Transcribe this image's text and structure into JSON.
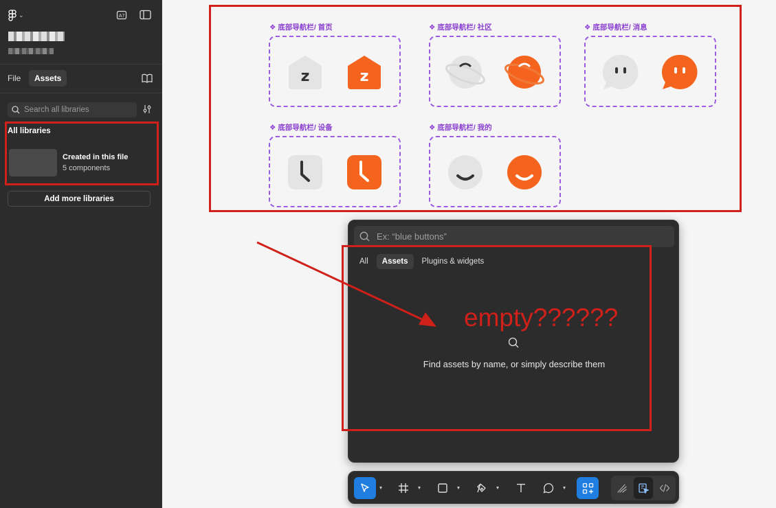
{
  "sidebar": {
    "tabs": {
      "file": "File",
      "assets": "Assets"
    },
    "search_placeholder": "Search all libraries",
    "all_libraries": "All libraries",
    "library": {
      "name": "Created in this file",
      "count": "5 components"
    },
    "add_more": "Add more libraries"
  },
  "canvas": {
    "components": [
      {
        "label": "❖ 底部导航栏/ 首页",
        "icon": "home-icon"
      },
      {
        "label": "❖ 底部导航栏/ 社区",
        "icon": "planet-icon"
      },
      {
        "label": "❖ 底部导航栏/ 消息",
        "icon": "chat-icon"
      },
      {
        "label": "❖ 底部导航栏/ 设备",
        "icon": "clock-icon"
      },
      {
        "label": "❖ 底部导航栏/ 我的",
        "icon": "smile-icon"
      }
    ]
  },
  "quick_actions": {
    "search_placeholder": "Ex: “blue buttons”",
    "tabs": [
      "All",
      "Assets",
      "Plugins & widgets"
    ],
    "empty_text": "Find assets by name, or simply describe them"
  },
  "annotation": {
    "text": "empty??????"
  },
  "colors": {
    "accent": "#1f7ee0",
    "annotation": "#d0201a",
    "orange": "#f5641e",
    "purple": "#9b5ce0"
  }
}
